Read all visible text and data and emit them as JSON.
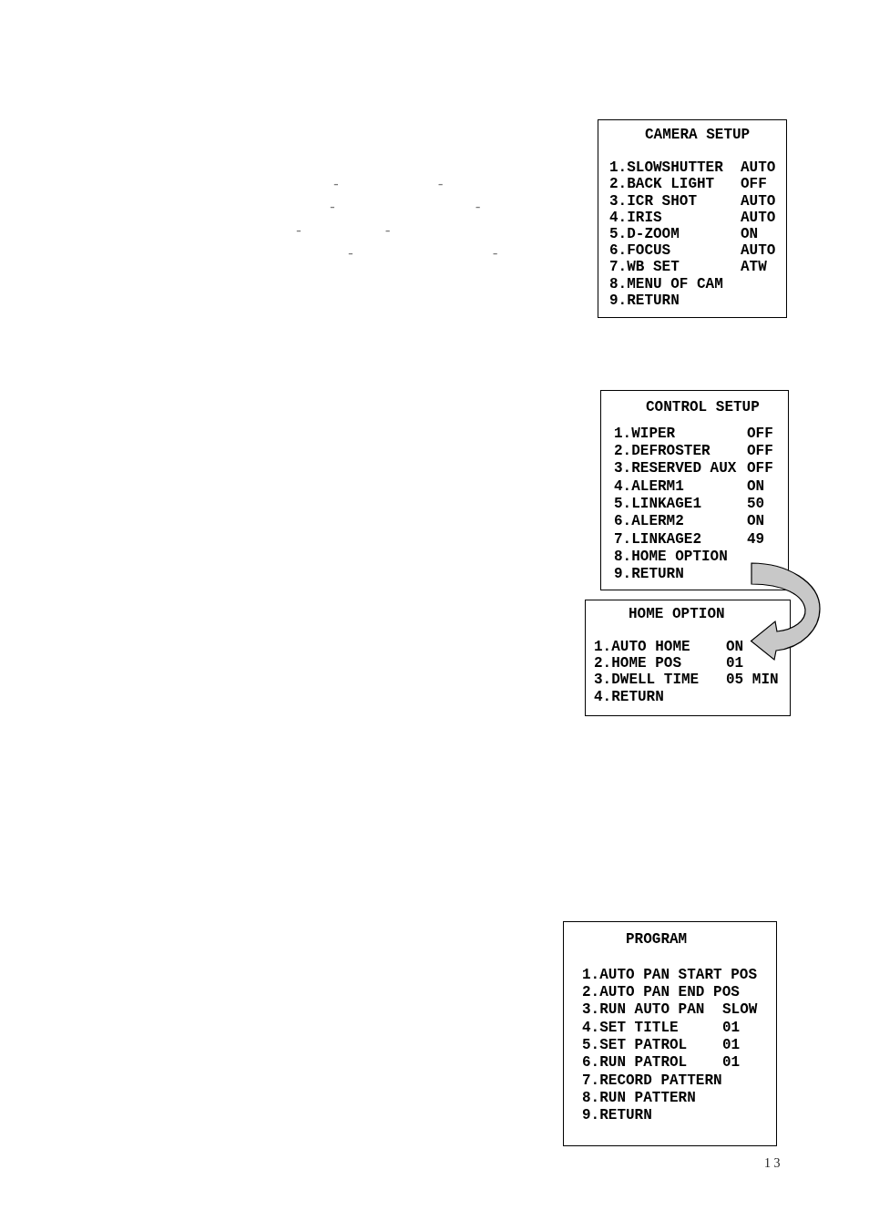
{
  "margin_marks": [
    [
      "-",
      "-"
    ],
    [
      "-",
      "-"
    ],
    [
      "-",
      "-"
    ],
    [
      "-",
      "-"
    ]
  ],
  "menus": [
    {
      "title": "CAMERA SETUP",
      "items": [
        {
          "label": "1.SLOWSHUTTER",
          "value": "AUTO"
        },
        {
          "label": "2.BACK LIGHT",
          "value": "OFF"
        },
        {
          "label": "3.ICR SHOT",
          "value": "AUTO"
        },
        {
          "label": "4.IRIS",
          "value": "AUTO"
        },
        {
          "label": "5.D-ZOOM",
          "value": "ON"
        },
        {
          "label": "6.FOCUS",
          "value": "AUTO"
        },
        {
          "label": "7.WB SET",
          "value": "ATW"
        },
        {
          "label": "8.MENU OF CAM"
        },
        {
          "label": "9.RETURN"
        }
      ]
    },
    {
      "title": "CONTROL SETUP",
      "items": [
        {
          "label": "1.WIPER",
          "value": "OFF"
        },
        {
          "label": "2.DEFROSTER",
          "value": "OFF"
        },
        {
          "label": "3.RESERVED AUX",
          "value": "OFF"
        },
        {
          "label": "4.ALERM1",
          "value": "ON"
        },
        {
          "label": "5.LINKAGE1",
          "value": "50"
        },
        {
          "label": "6.ALERM2",
          "value": "ON"
        },
        {
          "label": "7.LINKAGE2",
          "value": "49"
        },
        {
          "label": "8.HOME OPTION"
        },
        {
          "label": "9.RETURN"
        }
      ]
    },
    {
      "title": "HOME OPTION",
      "items": [
        {
          "label": "1.AUTO HOME",
          "value": "ON"
        },
        {
          "label": "2.HOME POS",
          "value": "01"
        },
        {
          "label": "3.DWELL TIME",
          "value": "05 MIN"
        },
        {
          "label": "4.RETURN"
        }
      ]
    },
    {
      "title": "PROGRAM",
      "items": [
        {
          "label": "1.AUTO PAN START POS"
        },
        {
          "label": "2.AUTO PAN END POS"
        },
        {
          "label": "3.RUN AUTO PAN",
          "value": "SLOW"
        },
        {
          "label": "4.SET TITLE",
          "value": "01"
        },
        {
          "label": "5.SET PATROL",
          "value": "01"
        },
        {
          "label": "6.RUN PATROL",
          "value": "01"
        },
        {
          "label": "7.RECORD PATTERN"
        },
        {
          "label": "8.RUN PATTERN"
        },
        {
          "label": "9.RETURN"
        }
      ]
    }
  ],
  "page_number": "1 3"
}
